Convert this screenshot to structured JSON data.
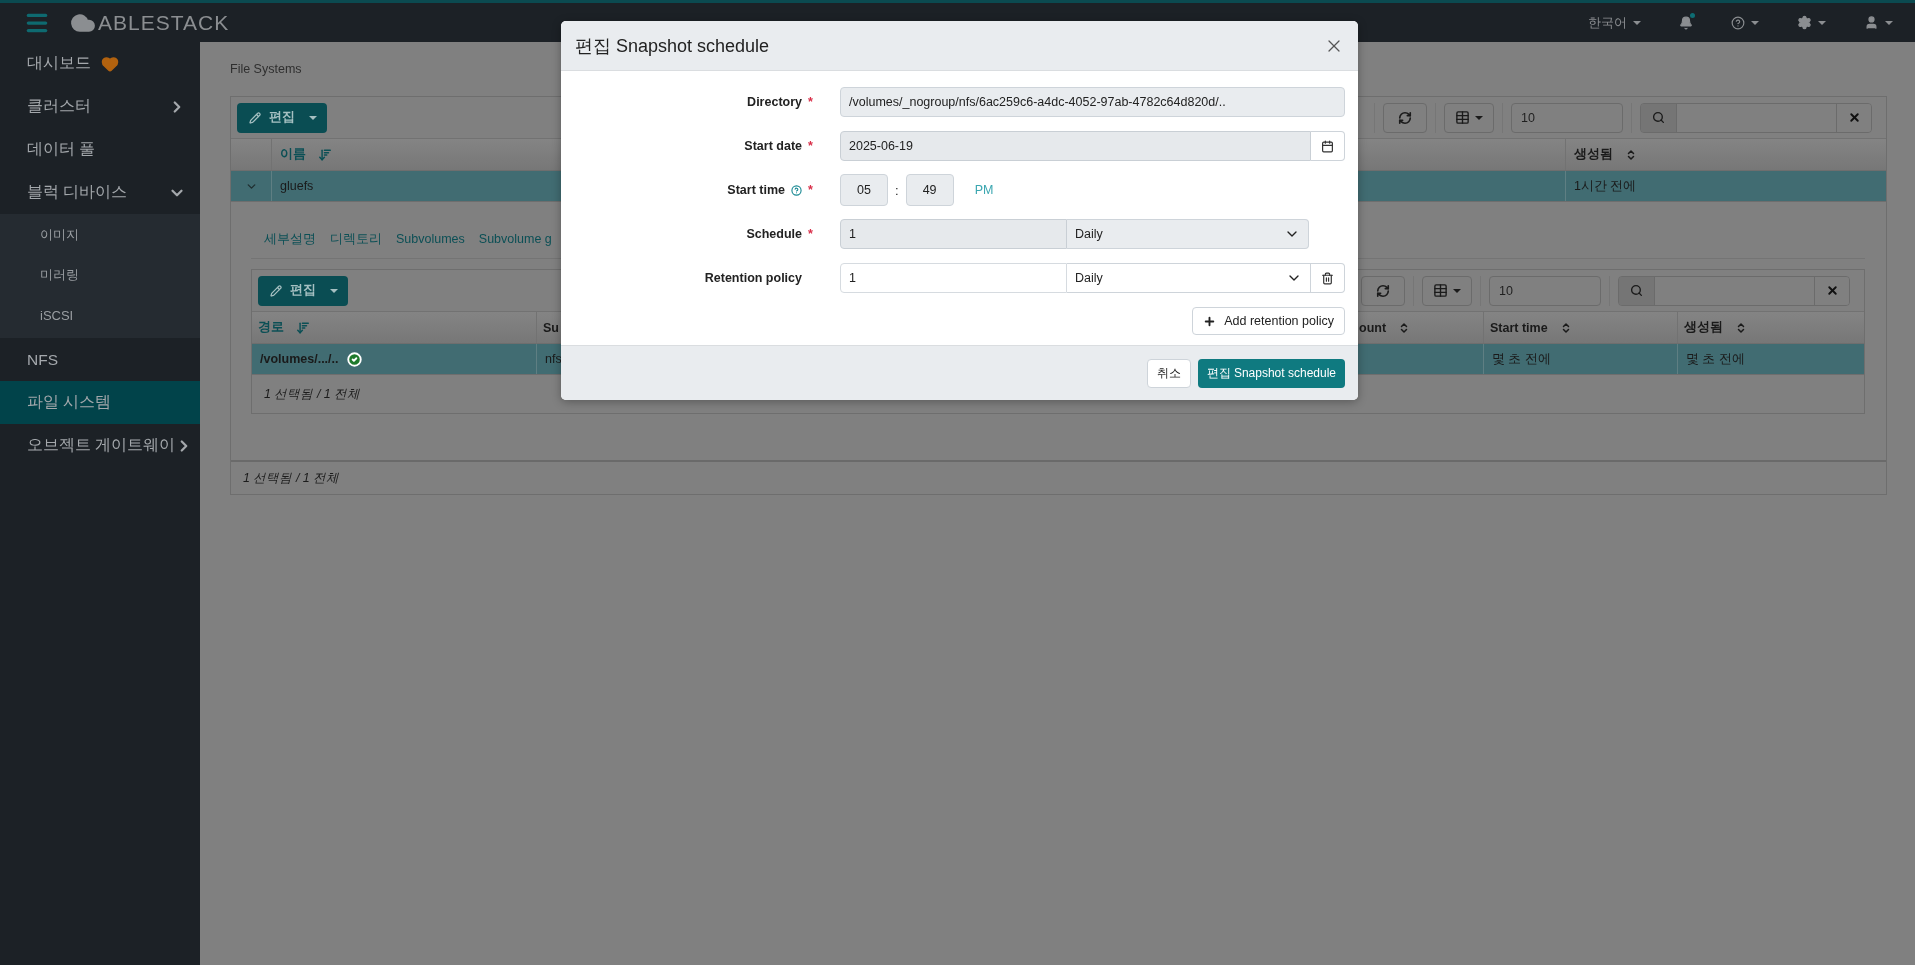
{
  "header": {
    "brand": "ABLESTACK",
    "language": "한국어",
    "notification": true
  },
  "sidebar": {
    "items": [
      {
        "label": "대시보드",
        "kind": "link",
        "selected": false,
        "health": true
      },
      {
        "label": "클러스터",
        "kind": "group",
        "selected": false,
        "expanded": false
      },
      {
        "label": "데이터 풀",
        "kind": "link",
        "selected": false
      },
      {
        "label": "블럭 디바이스",
        "kind": "group",
        "selected": false,
        "expanded": true,
        "children": [
          {
            "label": "이미지",
            "selected": false
          },
          {
            "label": "미러링",
            "selected": false
          },
          {
            "label": "iSCSI",
            "selected": false
          }
        ]
      },
      {
        "label": "NFS",
        "kind": "link",
        "selected": false
      },
      {
        "label": "파일 시스템",
        "kind": "link",
        "selected": true
      },
      {
        "label": "오브젝트 게이트웨이",
        "kind": "group",
        "selected": false,
        "expanded": false
      }
    ]
  },
  "page": {
    "breadcrumb": "File Systems",
    "table": {
      "edit_button": "편집",
      "page_size": "10",
      "columns": [
        {
          "label": "이름",
          "sorted": true
        },
        {
          "label": "생성됨",
          "sorted": false
        }
      ],
      "rows": [
        {
          "name": "gluefs",
          "created": "1시간 전에",
          "selected": true,
          "expanded": true
        }
      ],
      "detail": {
        "tabs": [
          {
            "label": "세부설명",
            "selected": false
          },
          {
            "label": "디렉토리",
            "selected": false
          },
          {
            "label": "Subvolumes",
            "selected": false
          },
          {
            "label": "Subvolume g",
            "selected": false
          }
        ],
        "table": {
          "edit_button": "편집",
          "page_size": "10",
          "columns": [
            {
              "label": "경로",
              "sorted": true
            },
            {
              "label": "Su"
            },
            {
              "label": "ount",
              "sorted": false
            },
            {
              "label": "Start time",
              "sorted": false
            },
            {
              "label": "생성됨",
              "sorted": false
            }
          ],
          "rows": [
            {
              "path": "/volumes/.../..",
              "healthy": true,
              "subvolume": "nfs",
              "start_time": "몇 초 전에",
              "created": "몇 초 전에",
              "selected": true
            }
          ],
          "footer": "1 선택됨 / 1 전체"
        }
      },
      "footer": "1 선택됨 / 1 전체"
    }
  },
  "modal": {
    "title": "편집 Snapshot schedule",
    "fields": [
      {
        "kind": "text",
        "label": "Directory",
        "required_mark": "*",
        "readonly": true,
        "value": "/volumes/_nogroup/nfs/6ac259c6-a4dc-4052-97ab-4782c64d820d/.."
      },
      {
        "kind": "date",
        "label": "Start date",
        "required_mark": "*",
        "readonly": true,
        "value": "2025-06-19"
      },
      {
        "kind": "time",
        "label": "Start time",
        "required_mark": "*",
        "readonly": true,
        "help": true,
        "hours": "05",
        "separator": ":",
        "minutes": "49",
        "meridiem": "PM"
      },
      {
        "kind": "interval",
        "label": "Schedule",
        "required_mark": "*",
        "readonly": true,
        "value": "1",
        "unit": "Daily"
      },
      {
        "kind": "interval",
        "label": "Retention policy",
        "readonly": false,
        "removable": true,
        "value": "1",
        "unit": "Daily"
      }
    ],
    "add_button": "Add retention policy",
    "cancel_button": "취소",
    "submit_button": "편집 Snapshot schedule"
  }
}
